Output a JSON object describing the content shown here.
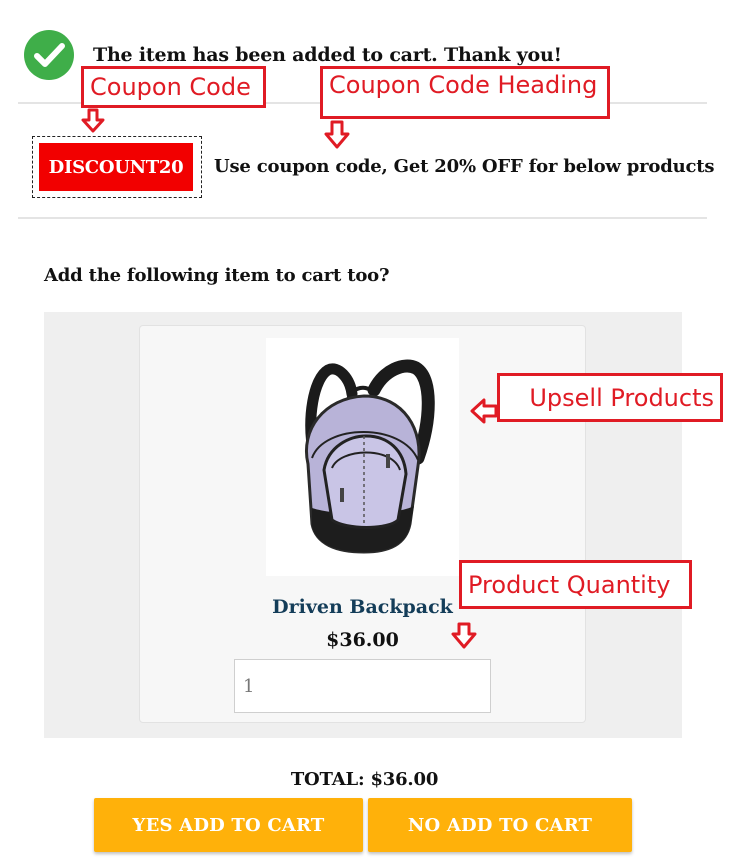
{
  "confirmation": {
    "message": "The item has been added to cart. Thank you!",
    "icon": "check-circle-icon",
    "icon_color": "#3fae49"
  },
  "coupon": {
    "code": "DISCOUNT20",
    "heading": "Use coupon code, Get 20% OFF for below products",
    "badge_color": "#f20000"
  },
  "upsell": {
    "title": "Add the following item to cart too?",
    "products": [
      {
        "name": "Driven Backpack",
        "price": "$36.00",
        "quantity": "1",
        "image_icon": "backpack-image"
      }
    ]
  },
  "footer": {
    "total": "TOTAL: $36.00",
    "yes_button": "YES ADD TO CART",
    "no_button": "NO ADD TO CART",
    "button_color": "#ffb10a"
  },
  "annotations": {
    "coupon_code": "Coupon Code",
    "coupon_code_heading": "Coupon Code Heading",
    "upsell_products": "Upsell Products",
    "product_quantity": "Product Quantity",
    "color": "#e01b24"
  }
}
